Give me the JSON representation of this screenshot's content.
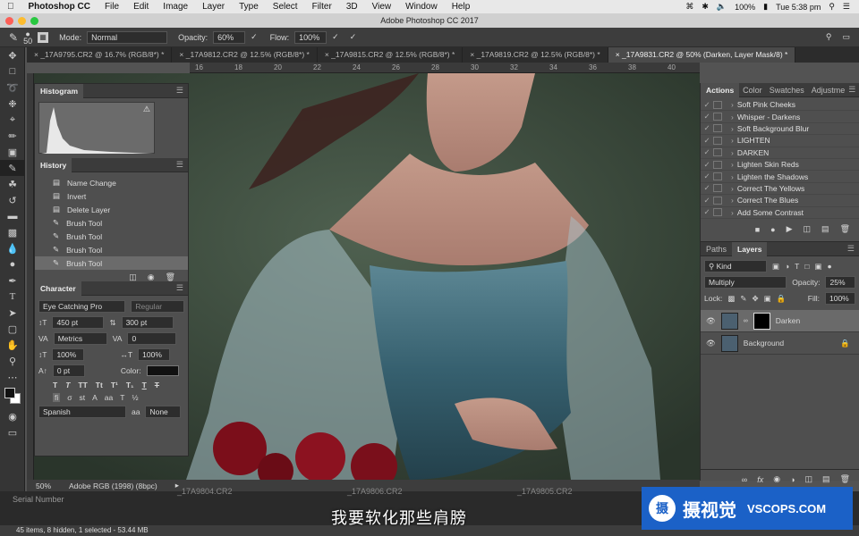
{
  "menubar": {
    "app": "Photoshop CC",
    "items": [
      "File",
      "Edit",
      "Image",
      "Layer",
      "Type",
      "Select",
      "Filter",
      "3D",
      "View",
      "Window",
      "Help"
    ],
    "battery": "100%",
    "clock": "Tue 5:38 pm"
  },
  "window": {
    "title": "Adobe Photoshop CC 2017"
  },
  "options": {
    "brush_size": "50",
    "mode_label": "Mode:",
    "mode_value": "Normal",
    "opacity_label": "Opacity:",
    "opacity_value": "60%",
    "flow_label": "Flow:",
    "flow_value": "100%"
  },
  "tabs": [
    "_17A9795.CR2 @ 16.7% (RGB/8*) *",
    "_17A9812.CR2 @ 12.5% (RGB/8*) *",
    "_17A9815.CR2 @ 12.5% (RGB/8*) *",
    "_17A9819.CR2 @ 12.5% (RGB/8*) *",
    "_17A9831.CR2 @ 50% (Darken, Layer Mask/8) *"
  ],
  "ruler": [
    "16",
    "18",
    "20",
    "22",
    "24",
    "26",
    "28",
    "30",
    "32",
    "34",
    "36",
    "38",
    "40"
  ],
  "histogram": {
    "title": "Histogram"
  },
  "history": {
    "title": "History",
    "items": [
      "Name Change",
      "Invert",
      "Delete Layer",
      "Brush Tool",
      "Brush Tool",
      "Brush Tool",
      "Brush Tool"
    ]
  },
  "character": {
    "title": "Character",
    "font": "Eye Catching Pro",
    "style": "Regular",
    "size": "450 pt",
    "leading": "300 pt",
    "kerning": "Metrics",
    "tracking": "0",
    "vscale": "100%",
    "hscale": "100%",
    "baseline": "0 pt",
    "color_label": "Color:",
    "language": "Spanish",
    "aa_label": "a",
    "aa_value": "None"
  },
  "actions": {
    "tabs": [
      "Actions",
      "Color",
      "Swatches",
      "Adjustme"
    ],
    "items": [
      "Soft Pink Cheeks",
      "Whisper - Darkens",
      "Soft Background Blur",
      "LIGHTEN",
      "DARKEN",
      "Lighten Skin Reds",
      "Lighten the Shadows",
      "Correct The Yellows",
      "Correct The Blues",
      "Add Some Contrast"
    ]
  },
  "layers": {
    "tabs": [
      "Paths",
      "Layers"
    ],
    "filter": "Kind",
    "blend": "Multiply",
    "opacity_label": "Opacity:",
    "opacity_value": "25%",
    "lock_label": "Lock:",
    "fill_label": "Fill:",
    "fill_value": "100%",
    "items": [
      "Darken",
      "Background"
    ]
  },
  "status": {
    "zoom": "50%",
    "profile": "Adobe RGB (1998) (8bpc)"
  },
  "filmstrip": {
    "files": [
      "_17A9804.CR2",
      "_17A9806.CR2",
      "_17A9805.CR2"
    ]
  },
  "bottom": {
    "label1": "Serial Number",
    "info": "45 items, 8 hidden, 1 selected - 53.44 MB"
  },
  "subtitle": "我要软化那些肩膀",
  "watermark": {
    "icon_text": "摄",
    "cn": "摄视觉",
    "en": "VSCOPS.COM"
  }
}
